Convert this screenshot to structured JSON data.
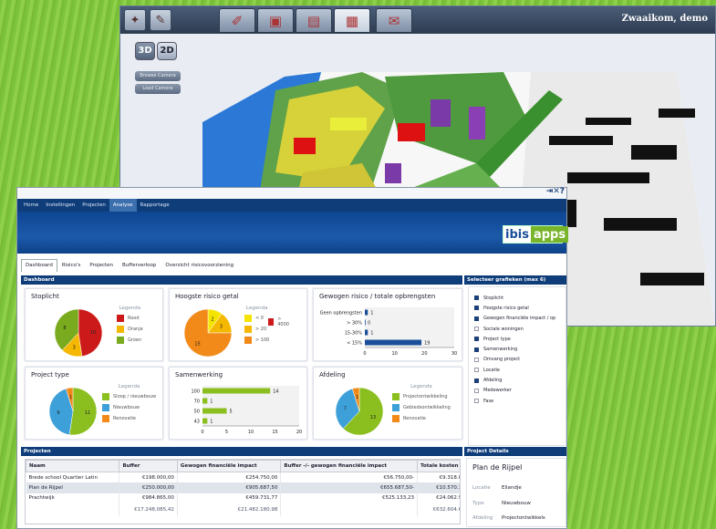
{
  "background_window": {
    "user": "Zwaaikom, demo",
    "view_buttons": [
      "3D",
      "2D"
    ],
    "camera_buttons": [
      "Browse Camera",
      "Load Camera"
    ]
  },
  "app": {
    "nav": [
      "Home",
      "Instellingen",
      "Projecten",
      "Analyse",
      "Rapportage"
    ],
    "active_nav": "Analyse",
    "logo_left": "ibis",
    "logo_right": "apps",
    "window_icons": "⇥✕?",
    "subtabs": [
      "Dashboard",
      "Risico's",
      "Projecten",
      "Bufferverloop",
      "Overzicht risicovoorziening"
    ],
    "active_subtab": "Dashboard"
  },
  "dashboard": {
    "header": "Dashboard",
    "select_header": "Selecteer grafieken (max 6)",
    "select_items": [
      {
        "label": "Stoplicht",
        "checked": true
      },
      {
        "label": "Hoogste risico getal",
        "checked": true
      },
      {
        "label": "Gewogen financiële impact / op",
        "checked": true
      },
      {
        "label": "Sociale woningen",
        "checked": false
      },
      {
        "label": "Project type",
        "checked": true
      },
      {
        "label": "Samenwerking",
        "checked": true
      },
      {
        "label": "Omvang project",
        "checked": false
      },
      {
        "label": "Locatie",
        "checked": false
      },
      {
        "label": "Afdeling",
        "checked": true
      },
      {
        "label": "Medewerker",
        "checked": false
      },
      {
        "label": "Fase",
        "checked": false
      }
    ]
  },
  "chart_data": [
    {
      "type": "pie",
      "title": "Stoplicht",
      "legend_title": "Legenda",
      "categories": [
        "Rood",
        "Oranje",
        "Groen"
      ],
      "values": [
        10,
        3,
        8
      ],
      "colors": [
        "#cc1a1a",
        "#f5b800",
        "#7aab1e"
      ]
    },
    {
      "type": "pie",
      "title": "Hoogste risico getal",
      "legend_title": "Legenda",
      "categories": [
        "< 0",
        "> 20",
        "> 100",
        "> 4000"
      ],
      "values": [
        2,
        3,
        15,
        0
      ],
      "colors": [
        "#f5e400",
        "#f5b800",
        "#f28a1a",
        "#cc1a1a"
      ]
    },
    {
      "type": "bar",
      "title": "Gewogen risico / totale opbrengsten",
      "legend_title": "Geen opbrengsten",
      "categories": [
        "Geen opbrengsten",
        "> 30%",
        "15-30%",
        "< 15%"
      ],
      "values": [
        1,
        0,
        1,
        19
      ],
      "xticks": [
        "0",
        "10",
        "20",
        "30"
      ],
      "xlim": [
        0,
        30
      ],
      "color": "#1b4f9a"
    },
    {
      "type": "pie",
      "title": "Project type",
      "legend_title": "Legenda",
      "categories": [
        "Sloop / nieuwbouw",
        "Nieuwbouw",
        "Renovatie"
      ],
      "values": [
        11,
        9,
        1
      ],
      "colors": [
        "#8bbf1f",
        "#3ea0d9",
        "#f28a1a"
      ]
    },
    {
      "type": "bar",
      "title": "Samenwerking",
      "categories": [
        "100",
        "70",
        "50",
        "43"
      ],
      "values": [
        14,
        1,
        5,
        1
      ],
      "xticks": [
        "0",
        "5",
        "10",
        "15",
        "20"
      ],
      "xlim": [
        0,
        20
      ],
      "color": "#8bbf1f"
    },
    {
      "type": "pie",
      "title": "Afdeling",
      "legend_title": "Legenda",
      "categories": [
        "Projectontwikkeling",
        "Gebiedsontwikkeling",
        "Renovatie"
      ],
      "values": [
        13,
        7,
        1
      ],
      "colors": [
        "#8bbf1f",
        "#3ea0d9",
        "#f28a1a"
      ]
    }
  ],
  "projects": {
    "header": "Projecten",
    "columns": [
      "Naam",
      "Buffer",
      "Gewogen financiële impact",
      "Buffer -/- gewogen financiële impact",
      "Totale kosten",
      "Totale opbren"
    ],
    "rows": [
      [
        "Brede school Quartier Latin",
        "€198.000,00",
        "€254.750,00",
        "€56.750,00-",
        "€9.318.000,00",
        "€9.668."
      ],
      [
        "Plan de Rijpel",
        "€250.000,00",
        "€905.687,50",
        "€655.687,50-",
        "€10.570.181,00",
        "€11.135."
      ],
      [
        "Prachtwijk",
        "€984.865,00",
        "€459.731,77",
        "€525.133,23",
        "€24.062.960,00",
        "€24.062."
      ]
    ],
    "totals": [
      "",
      "€17.248.085,42",
      "€21.482.180,98",
      "",
      "€632.604.661,00",
      "€633.241.1"
    ]
  },
  "details": {
    "header": "Project Details",
    "title": "Plan de Rijpel",
    "rows": [
      [
        "Locatie",
        "Eilandje"
      ],
      [
        "Type",
        "Nieuwbouw"
      ],
      [
        "Afdeling",
        "Projectontwikkels"
      ],
      [
        "Medewerker",
        "Boelwe der Kie"
      ]
    ]
  }
}
